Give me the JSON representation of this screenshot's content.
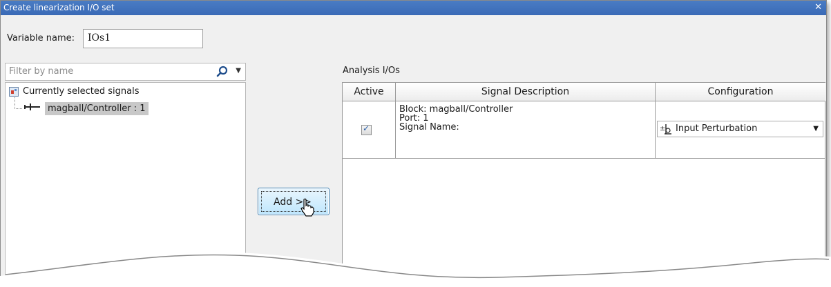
{
  "window": {
    "title": "Create linearization I/O set",
    "close_glyph": "✕"
  },
  "variable": {
    "label": "Variable name:",
    "value": "IOs1"
  },
  "filter": {
    "placeholder": "Filter by name",
    "icon": "search-icon"
  },
  "tree": {
    "root_label": "Currently selected signals",
    "child_label": "magball/Controller : 1"
  },
  "add_button": {
    "label": "Add >>"
  },
  "analysis": {
    "label": "Analysis I/Os",
    "columns": [
      "Active",
      "Signal Description",
      "Configuration"
    ],
    "rows": [
      {
        "active": true,
        "block": "Block: magball/Controller",
        "port": "Port: 1",
        "signal_name": "Signal Name:",
        "configuration": "Input Perturbation"
      }
    ]
  },
  "colors": {
    "titlebar": "#3a6ab6",
    "selection": "#c8c8c8",
    "button_border": "#3c7fb1"
  }
}
